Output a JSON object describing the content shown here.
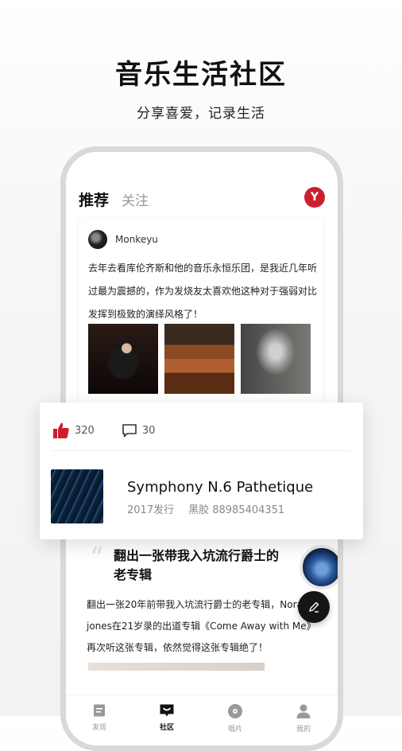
{
  "header": {
    "title": "音乐生活社区",
    "subtitle": "分享喜爱，记录生活"
  },
  "app": {
    "tabs": [
      {
        "label": "推荐",
        "active": true
      },
      {
        "label": "关注",
        "active": false
      }
    ],
    "logo_glyph": "Y",
    "accent_color": "#cc1f2e"
  },
  "post1": {
    "username": "Monkeyu",
    "text": "去年去看库伦齐斯和他的音乐永恒乐团，是我近几年听过最为震撼的，作为发烧友太喜欢他这种对于强弱对比发挥到极致的演绎风格了！"
  },
  "card": {
    "likes": "320",
    "comments": "30",
    "album_title": "Symphony N.6 Pathetique",
    "album_year": "2017发行",
    "album_format": "黑胶 88985404351"
  },
  "post2": {
    "title": "翻出一张带我入坑流行爵士的老专辑",
    "text": "翻出一张20年前带我入坑流行爵士的老专辑，Norah jones在21岁录的出道专辑《Come Away with Me》再次听这张专辑，依然觉得这张专辑绝了！"
  },
  "bottom_nav": [
    {
      "label": "发现",
      "icon": "discover-icon",
      "active": false
    },
    {
      "label": "社区",
      "icon": "community-icon",
      "active": true
    },
    {
      "label": "唱片",
      "icon": "record-icon",
      "active": false
    },
    {
      "label": "我的",
      "icon": "profile-icon",
      "active": false
    }
  ]
}
